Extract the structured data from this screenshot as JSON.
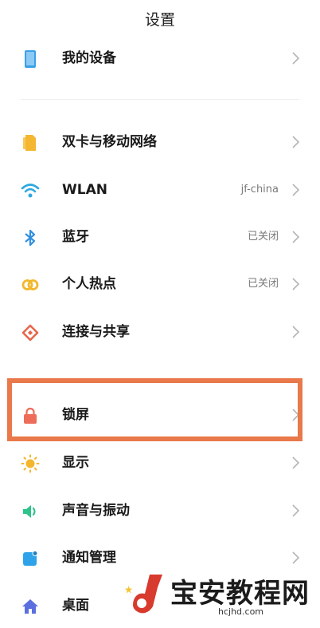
{
  "header": {
    "title": "设置"
  },
  "rows": [
    {
      "label": "我的设备",
      "value": ""
    },
    {
      "label": "双卡与移动网络",
      "value": ""
    },
    {
      "label": "WLAN",
      "value": "jf-china"
    },
    {
      "label": "蓝牙",
      "value": "已关闭"
    },
    {
      "label": "个人热点",
      "value": "已关闭"
    },
    {
      "label": "连接与共享",
      "value": ""
    },
    {
      "label": "锁屏",
      "value": ""
    },
    {
      "label": "显示",
      "value": ""
    },
    {
      "label": "声音与振动",
      "value": ""
    },
    {
      "label": "通知管理",
      "value": ""
    },
    {
      "label": "桌面",
      "value": ""
    }
  ],
  "icons": [
    "device-icon",
    "sim-card-icon",
    "wifi-icon",
    "bluetooth-icon",
    "hotspot-icon",
    "connection-share-icon",
    "lock-icon",
    "display-icon",
    "sound-icon",
    "notification-icon",
    "home-icon"
  ],
  "colors": {
    "device": "#3aa0e8",
    "sim": "#f5b731",
    "wifi": "#2ea8e0",
    "bluetooth": "#2f8fe0",
    "hotspot": "#f2b72b",
    "share": "#e7664a",
    "lock": "#ee6d5a",
    "display": "#f3b62d",
    "sound": "#2ec38a",
    "notification": "#2fa3ea",
    "home": "#5b6fe0",
    "highlight": "#e9784a"
  },
  "watermark": {
    "text": "宝安教程网",
    "url": "hcjhd.com"
  }
}
